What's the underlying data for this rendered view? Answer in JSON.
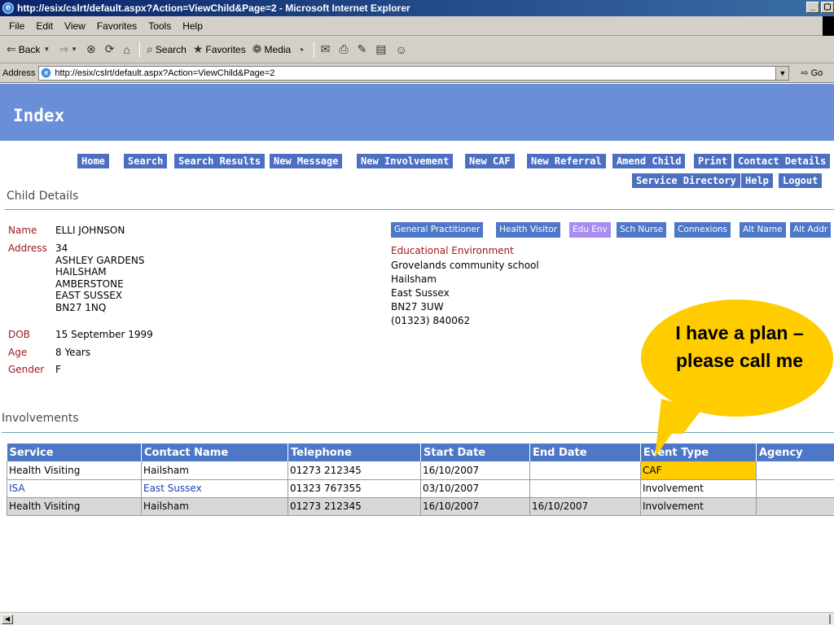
{
  "window": {
    "title": "http://esix/cslrt/default.aspx?Action=ViewChild&Page=2 - Microsoft Internet Explorer",
    "buttons": [
      "_",
      "▢"
    ]
  },
  "menu": [
    "File",
    "Edit",
    "View",
    "Favorites",
    "Tools",
    "Help"
  ],
  "toolbar": {
    "back": "Back",
    "search": "Search",
    "favorites": "Favorites",
    "media": "Media"
  },
  "address": {
    "label": "Address",
    "url": "http://esix/cslrt/default.aspx?Action=ViewChild&Page=2",
    "go": "Go"
  },
  "page": {
    "title": "Index",
    "nav_row1": [
      "Home",
      "Search",
      "Search Results",
      "New Message",
      "New Involvement",
      "New CAF",
      "New Referral",
      "Amend Child",
      "Print",
      "Contact Details"
    ],
    "nav_row2": [
      "Service Directory",
      "Help",
      "Logout"
    ],
    "child_details_heading": "Child Details",
    "child": {
      "name_label": "Name",
      "name": "ELLI JOHNSON",
      "address_label": "Address",
      "address_lines": [
        "34",
        "ASHLEY GARDENS",
        "HAILSHAM",
        "AMBERSTONE",
        "EAST SUSSEX",
        "BN27 1NQ"
      ],
      "dob_label": "DOB",
      "dob": "15 September 1999",
      "age_label": "Age",
      "age": "8 Years",
      "gender_label": "Gender",
      "gender": "F"
    },
    "tabs": [
      "General Practitioner",
      "Health Visitor",
      "Edu Env",
      "Sch Nurse",
      "Connexions",
      "Alt Name",
      "Alt Addr"
    ],
    "active_tab": "Edu Env",
    "edu": {
      "title": "Educational Environment",
      "lines": [
        "Grovelands community school",
        "Hailsham",
        "East Sussex",
        "BN27 3UW",
        "(01323) 840062"
      ]
    },
    "involvements_heading": "Involvements",
    "table": {
      "headers": [
        "Service",
        "Contact Name",
        "Telephone",
        "Start Date",
        "End Date",
        "Event Type",
        "Agency"
      ],
      "rows": [
        [
          "Health Visiting",
          "Hailsham",
          "01273 212345",
          "16/10/2007",
          "",
          "CAF",
          ""
        ],
        [
          "ISA",
          "East Sussex",
          "01323 767355",
          "03/10/2007",
          "",
          "Involvement",
          ""
        ],
        [
          "Health Visiting",
          "Hailsham",
          "01273 212345",
          "16/10/2007",
          "16/10/2007",
          "Involvement",
          ""
        ]
      ]
    },
    "callout": "I have a plan – please call me"
  },
  "colors": {
    "header_band": "#6a8fd8",
    "nav_button": "#4d6fc0",
    "tab": "#4d78c8",
    "tab_active": "#a88ef0",
    "label_red": "#a01818",
    "callout_yellow": "#ffcc00"
  }
}
